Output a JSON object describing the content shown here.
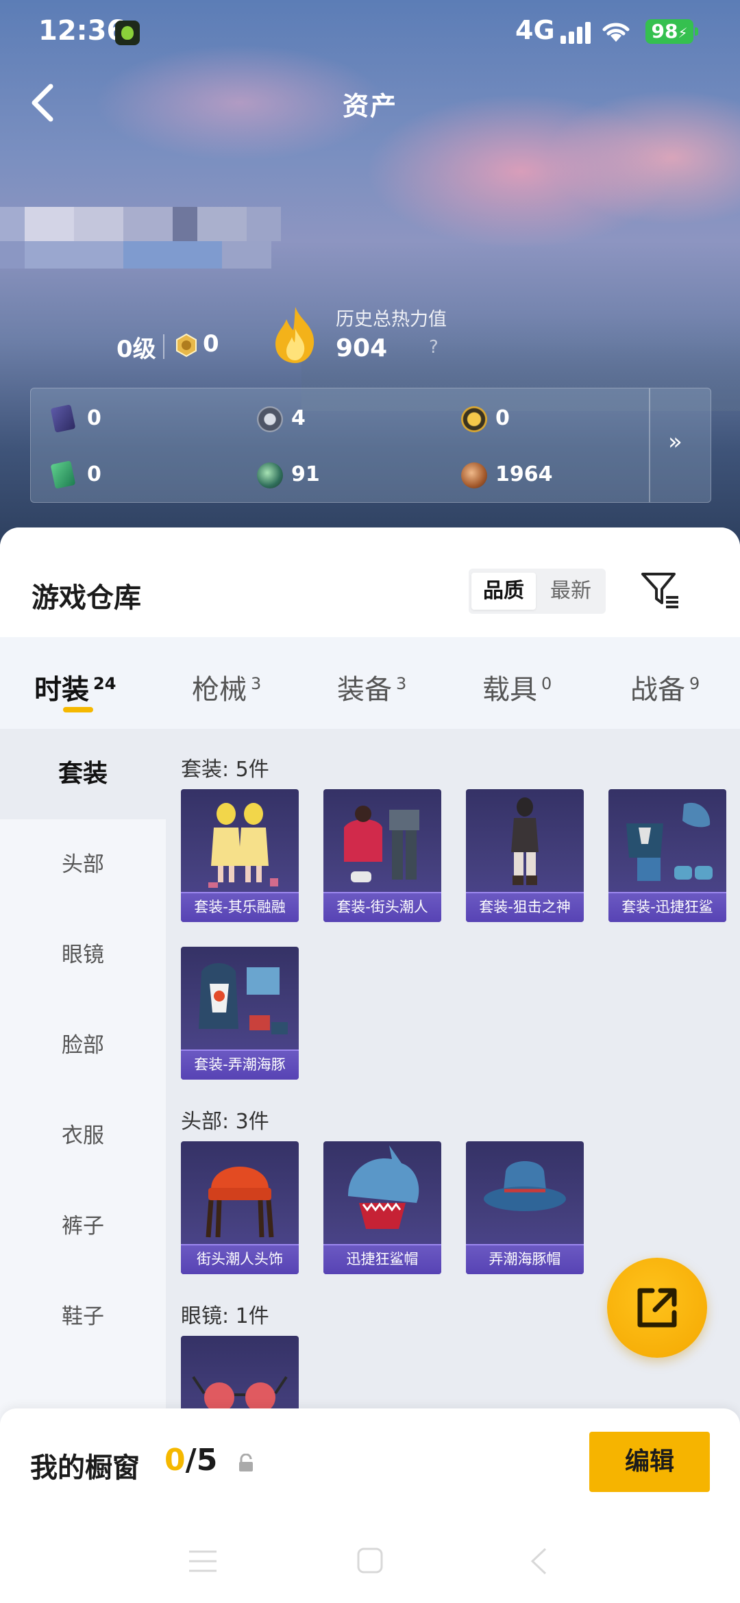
{
  "status_bar": {
    "time": "12:36",
    "network": "4G",
    "battery": "98"
  },
  "header": {
    "title": "资产"
  },
  "profile": {
    "level": "0级",
    "rank_value": "0",
    "heat_label": "历史总热力值",
    "heat_value": "904",
    "heat_help": "?"
  },
  "assets": [
    {
      "icon": "card-ticket-icon",
      "value": "0"
    },
    {
      "icon": "silver-coin-icon",
      "value": "4"
    },
    {
      "icon": "gold-token-icon",
      "value": "0"
    },
    {
      "icon": "green-card-icon",
      "value": "0"
    },
    {
      "icon": "green-orb-icon",
      "value": "91"
    },
    {
      "icon": "bronze-coin-icon",
      "value": "1964"
    }
  ],
  "warehouse": {
    "title": "游戏仓库",
    "sort_options": [
      "品质",
      "最新"
    ],
    "sort_selected": "品质"
  },
  "tabs": [
    {
      "label": "时装",
      "count": "24",
      "active": true
    },
    {
      "label": "枪械",
      "count": "3"
    },
    {
      "label": "装备",
      "count": "3"
    },
    {
      "label": "载具",
      "count": "0"
    },
    {
      "label": "战备",
      "count": "9"
    }
  ],
  "sidebar": {
    "items": [
      "套装",
      "头部",
      "眼镜",
      "脸部",
      "衣服",
      "裤子",
      "鞋子"
    ],
    "active": "套装"
  },
  "sections": [
    {
      "title": "套装: 5件",
      "items": [
        "套装-其乐融融",
        "套装-街头潮人",
        "套装-狙击之神",
        "套装-迅捷狂鲨",
        "套装-弄潮海豚"
      ]
    },
    {
      "title": "头部: 3件",
      "items": [
        "街头潮人头饰",
        "迅捷狂鲨帽",
        "弄潮海豚帽"
      ]
    },
    {
      "title": "眼镜: 1件",
      "items": [
        ""
      ]
    }
  ],
  "showcase": {
    "title": "我的橱窗",
    "current": "0",
    "total": "/5",
    "edit_label": "编辑"
  },
  "colors": {
    "accent": "#f5b800",
    "card_label": "#5743b4",
    "fab": "#f4a700"
  }
}
